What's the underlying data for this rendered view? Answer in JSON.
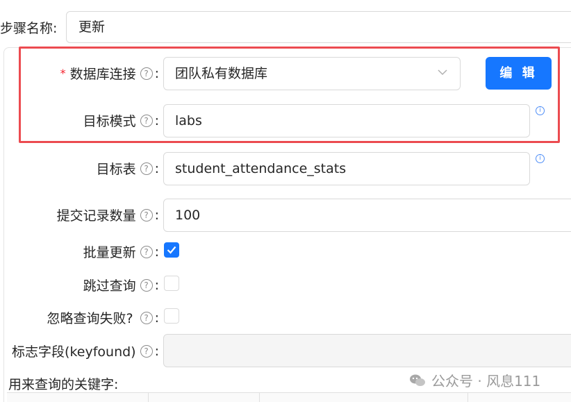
{
  "step": {
    "label": "步骤名称:",
    "value": "更新"
  },
  "db_connection": {
    "required_mark": "*",
    "label": "数据库连接",
    "value": "团队私有数据库"
  },
  "edit_button": {
    "label": "编 辑"
  },
  "target_schema": {
    "label": "目标模式",
    "value": "labs"
  },
  "target_table": {
    "label": "目标表",
    "value": "student_attendance_stats"
  },
  "commit_size": {
    "label": "提交记录数量",
    "value": "100"
  },
  "batch_update": {
    "label": "批量更新",
    "checked": true
  },
  "skip_lookup": {
    "label": "跳过查询",
    "checked": false
  },
  "ignore_lookup_failure": {
    "label": "忽略查询失败?",
    "checked": false
  },
  "flag_field": {
    "label": "标志字段(keyfound)",
    "value": ""
  },
  "keyword_section": {
    "label": "用来查询的关键字:"
  },
  "watermark": {
    "text": "公众号 · 风息111"
  },
  "help_glyph": "?",
  "colon": ":",
  "colors": {
    "primary": "#1677ff",
    "highlight": "#ec4b50",
    "required": "#f5222d"
  }
}
